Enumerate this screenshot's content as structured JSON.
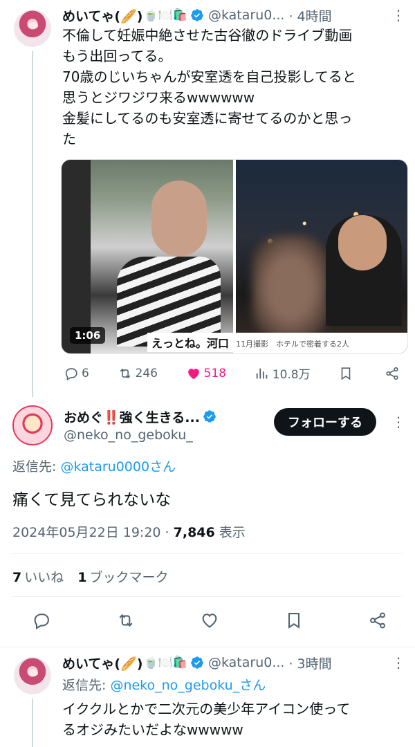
{
  "tweet1": {
    "display_name": "めいてゃ(🥖)",
    "emojis": "🍵🍽️🛍️",
    "handle": "@kataru0...",
    "time": "4時間",
    "text": "不倫して妊娠中絶させた古谷徹のドライブ動画\nもう出回ってる。\n70歳のじいちゃんが安室透を自己投影してると\n思うとジワジワ来るwwwwww\n金髪にしてるのも安室透に寄せてるのかと思っ\nた",
    "media": {
      "video_duration": "1:06",
      "left_caption": "えっとね。河口",
      "right_caption": "11月撮影　ホテルで密着する2人"
    },
    "actions": {
      "replies": "6",
      "retweets": "246",
      "likes": "518",
      "views": "10.8万"
    }
  },
  "main_tweet": {
    "display_name": "おめぐ‼️強く生きる...",
    "handle": "@neko_no_geboku_",
    "follow_label": "フォローする",
    "reply_prefix": "返信先: ",
    "reply_mention": "@kataru0000さん",
    "text": "痛くて見てられないな",
    "date": "2024年05月22日 19:20",
    "sep": " · ",
    "views_count": "7,846",
    "views_label": " 表示",
    "likes_count": "7",
    "likes_label": "いいね",
    "bookmarks_count": "1",
    "bookmarks_label": "ブックマーク"
  },
  "tweet3": {
    "display_name": "めいてゃ(🥖)",
    "emojis": "🍵🍽️🛍️",
    "handle": "@kataru0...",
    "time": "3時間",
    "reply_prefix": "返信先: ",
    "reply_mention": "@neko_no_geboku_さん",
    "text": "イククルとかで二次元の美少年アイコン使って\nるオジみたいだよなwwwww"
  },
  "colors": {
    "accent": "#1d9bf0",
    "like": "#f91880",
    "text": "#0f1419",
    "muted": "#536471"
  },
  "icons": [
    "verified-icon",
    "reply-icon",
    "retweet-icon",
    "heart-icon",
    "views-icon",
    "bookmark-icon",
    "share-icon",
    "more-icon"
  ]
}
